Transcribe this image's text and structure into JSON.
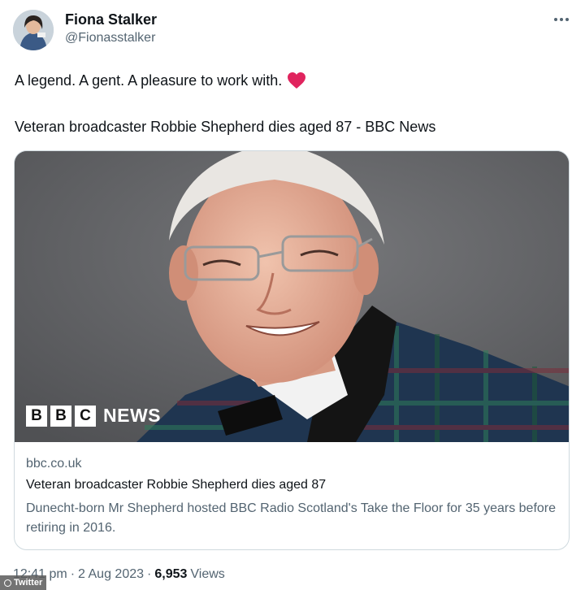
{
  "author": {
    "name": "Fiona Stalker",
    "handle": "@Fionasstalker"
  },
  "tweet": {
    "text": "A legend. A gent. A pleasure to work with.",
    "emoji": "heart-emoji",
    "link_text": "Veteran broadcaster Robbie Shepherd dies aged 87 - BBC News"
  },
  "card": {
    "logo_blocks": [
      "B",
      "B",
      "C"
    ],
    "logo_word": "NEWS",
    "domain": "bbc.co.uk",
    "title": "Veteran broadcaster Robbie Shepherd dies aged 87",
    "description": "Dunecht-born Mr Shepherd hosted BBC Radio Scotland's Take the Floor for 35 years before retiring in 2016."
  },
  "meta": {
    "time": "12:41 pm",
    "separator": "·",
    "date": "2 Aug 2023",
    "views_count": "6,953",
    "views_label": "Views"
  },
  "watermark": {
    "label": "Twitter"
  },
  "colors": {
    "text_primary": "#0f1419",
    "text_secondary": "#536471",
    "card_border": "#cfd9de",
    "heart": "#e0245e",
    "photo_background": "#5e5f62"
  },
  "icons": {
    "more": "more-horizontal-icon",
    "heart": "heart-icon"
  }
}
